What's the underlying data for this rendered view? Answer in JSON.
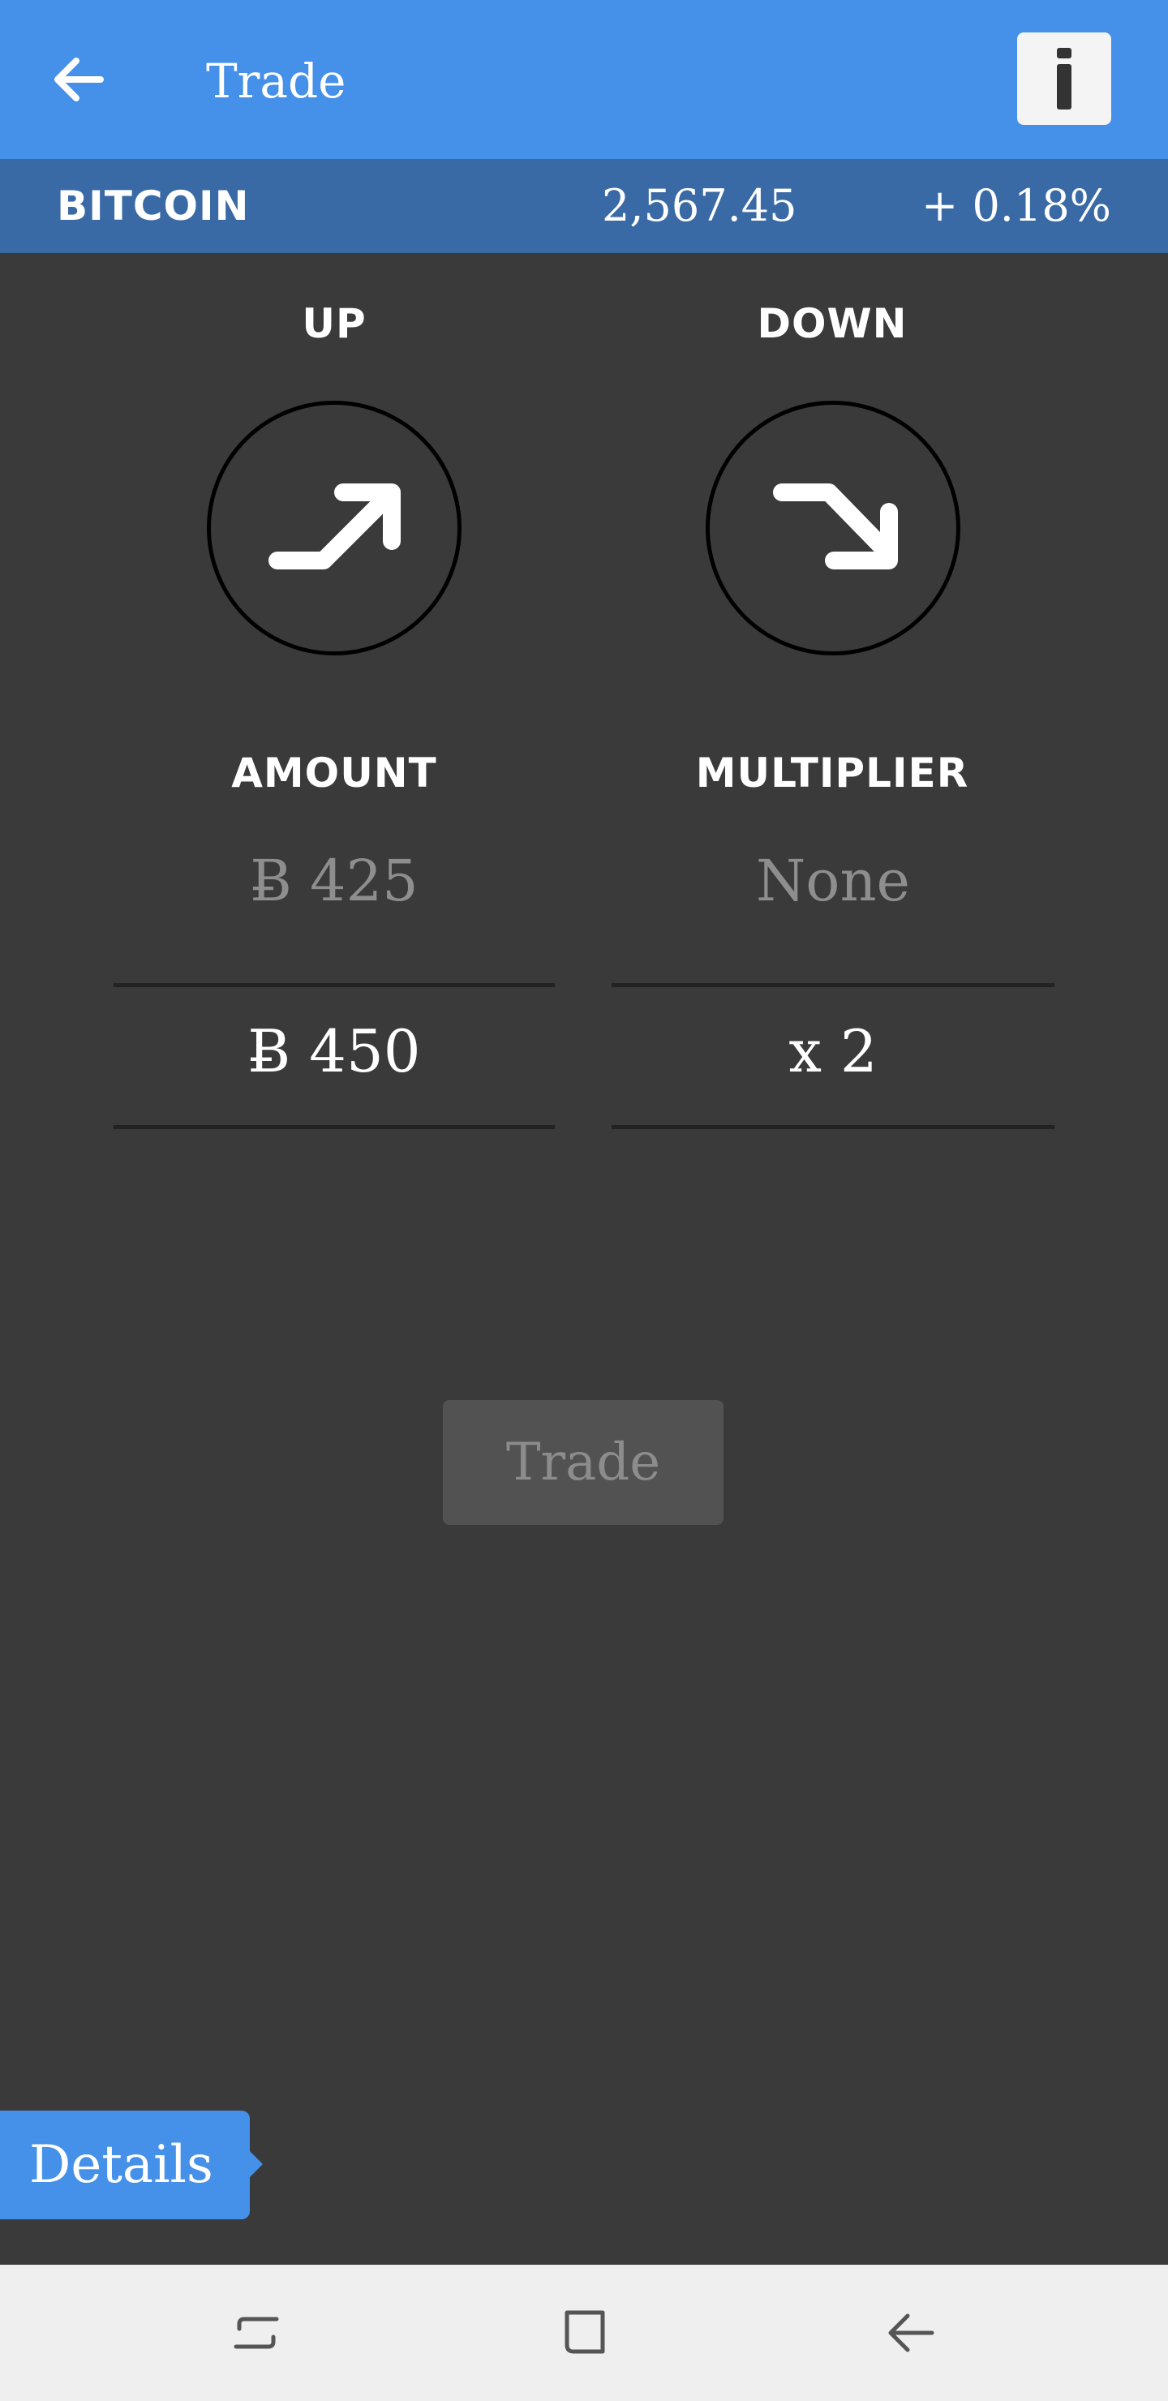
{
  "header": {
    "title": "Trade",
    "back_icon": "arrow-left-icon",
    "info_icon": "info-icon"
  },
  "ticker": {
    "name": "BITCOIN",
    "price": "2,567.45",
    "change": "+ 0.18%"
  },
  "direction": {
    "up_label": "UP",
    "down_label": "DOWN"
  },
  "amount": {
    "label": "AMOUNT",
    "placeholder": "Ƀ 425",
    "value": "Ƀ 450"
  },
  "multiplier": {
    "label": "MULTIPLIER",
    "placeholder": "None",
    "value": "x 2"
  },
  "trade_button": "Trade",
  "details_tab": "Details",
  "colors": {
    "primary": "#4590e8",
    "ticker_bg": "#3a6aa5",
    "background": "#3a3a3a",
    "nav_bg": "#efefef"
  }
}
